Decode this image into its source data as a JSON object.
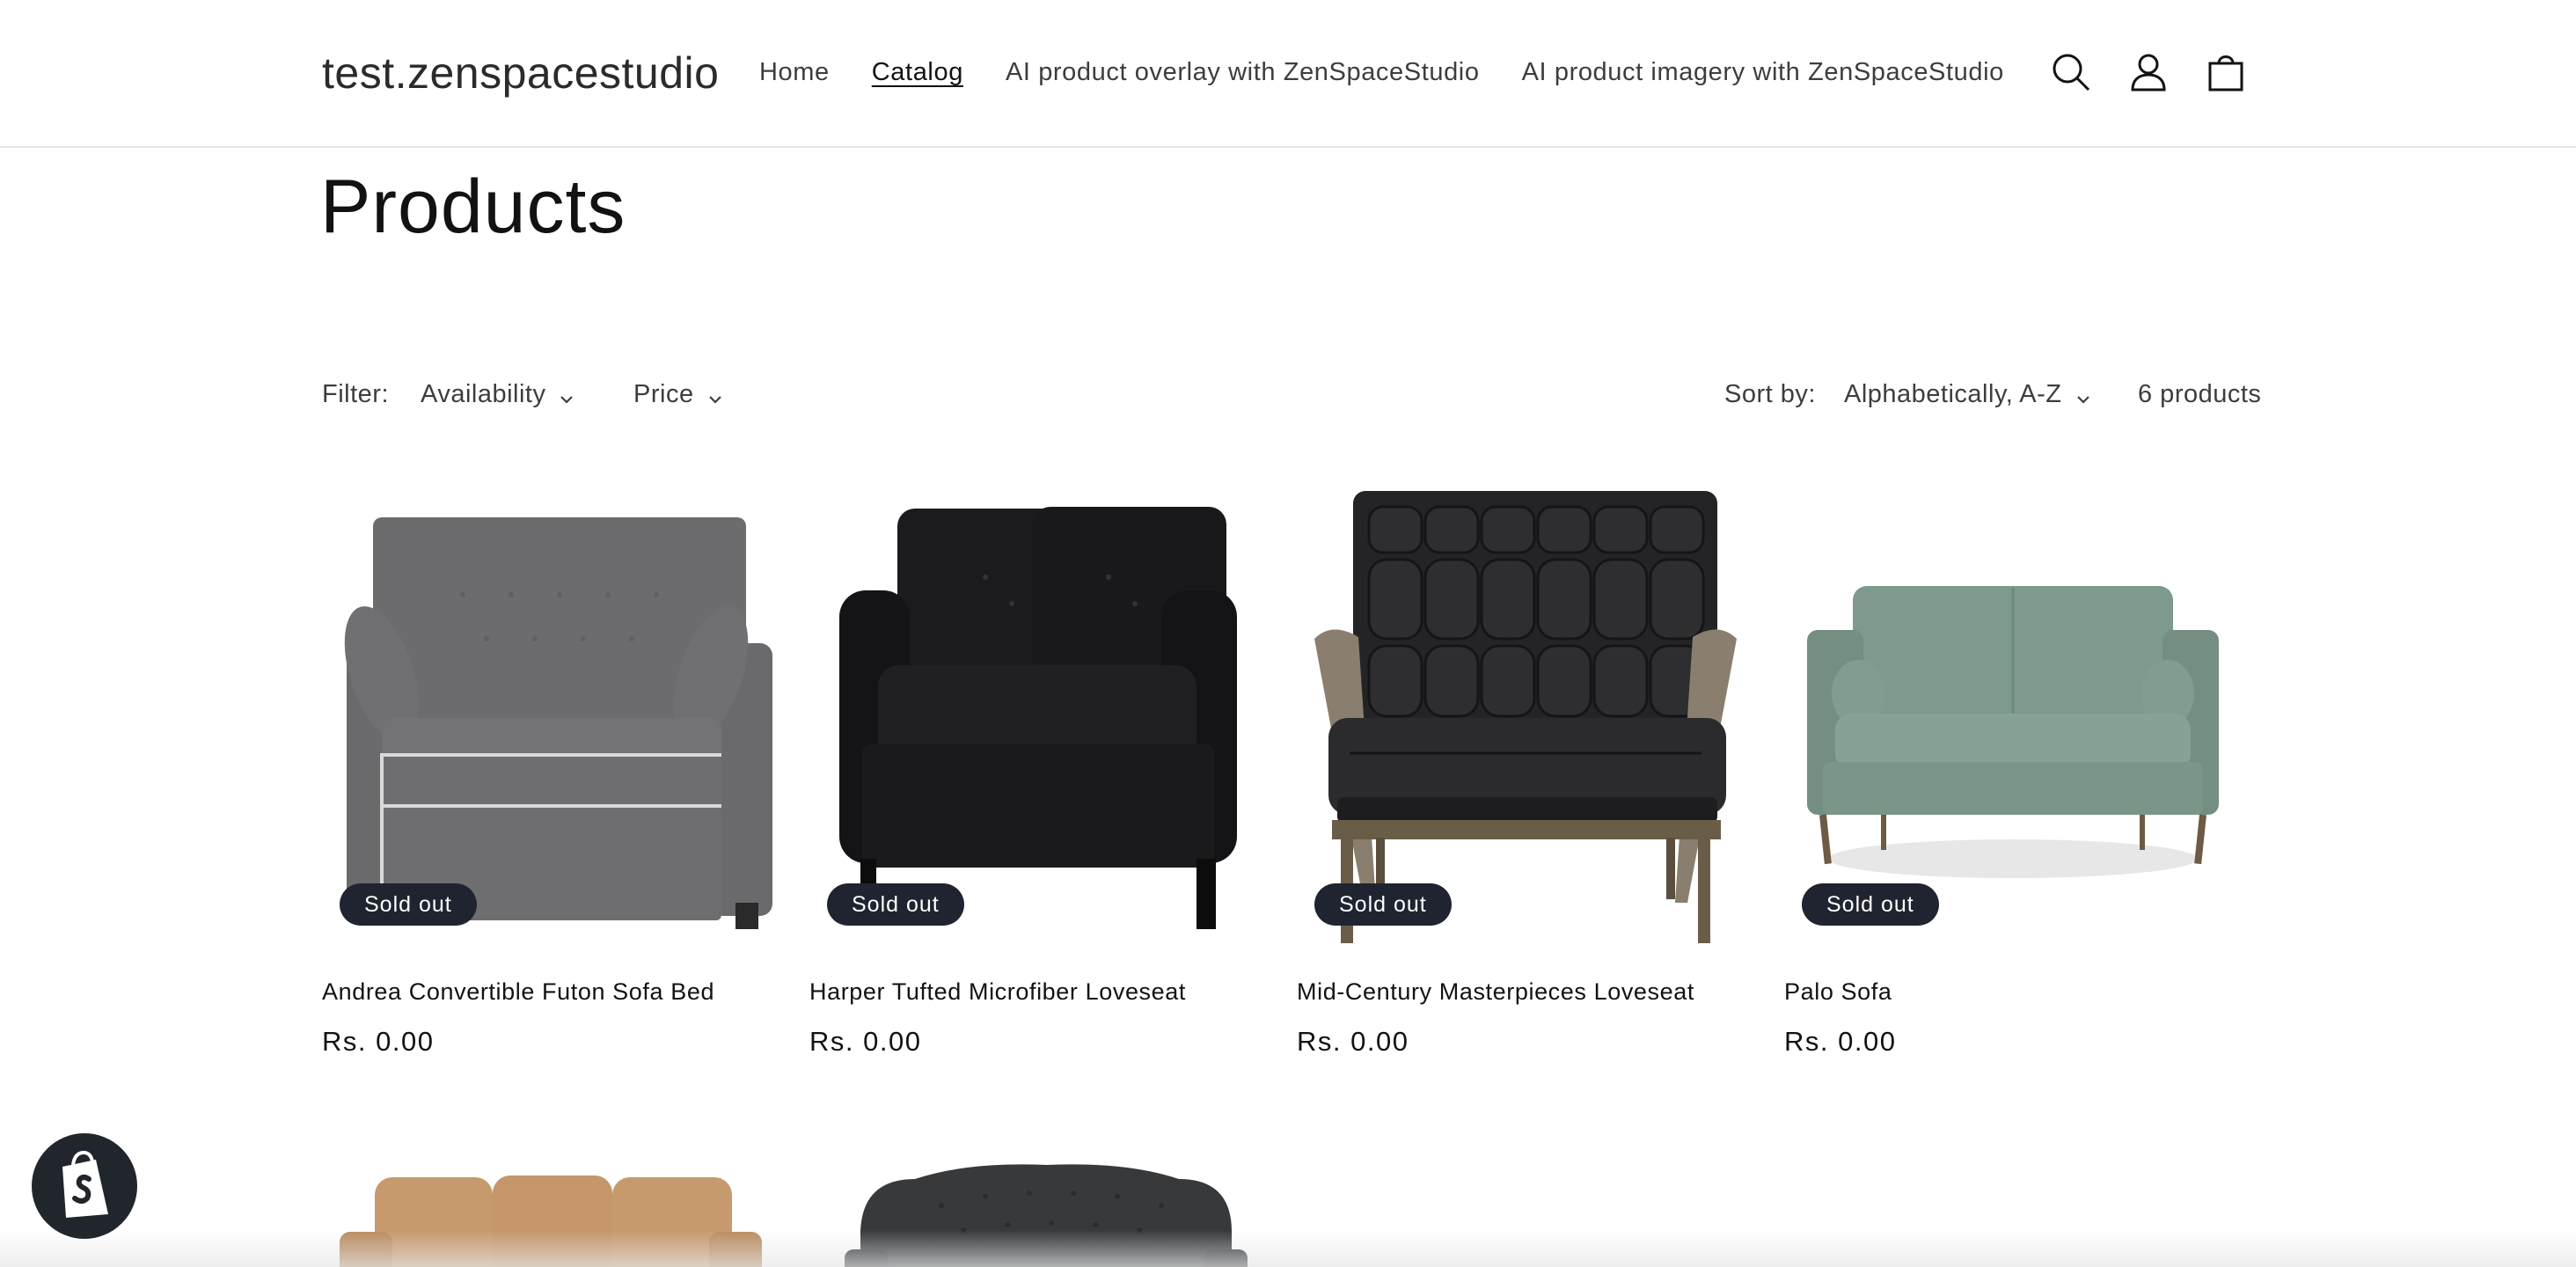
{
  "header": {
    "logo": "test.zenspacestudio",
    "nav": [
      {
        "label": "Home"
      },
      {
        "label": "Catalog",
        "active": true
      },
      {
        "label": "AI product overlay with ZenSpaceStudio"
      },
      {
        "label": "AI product imagery with ZenSpaceStudio"
      }
    ],
    "icons": [
      "search-icon",
      "account-icon",
      "cart-icon"
    ]
  },
  "page": {
    "title": "Products"
  },
  "filters": {
    "label": "Filter:",
    "availability": "Availability",
    "price": "Price",
    "sort_label": "Sort by:",
    "sort_value": "Alphabetically, A-Z",
    "count": "6 products"
  },
  "products": [
    {
      "title": "Andrea Convertible Futon Sofa Bed",
      "price": "Rs. 0.00",
      "badge": "Sold out"
    },
    {
      "title": "Harper Tufted Microfiber Loveseat",
      "price": "Rs. 0.00",
      "badge": "Sold out"
    },
    {
      "title": "Mid-Century Masterpieces Loveseat",
      "price": "Rs. 0.00",
      "badge": "Sold out"
    },
    {
      "title": "Palo Sofa",
      "price": "Rs. 0.00",
      "badge": "Sold out"
    }
  ],
  "colors": {
    "badge_bg": "#1f2430",
    "text": "#121212",
    "sage": "#7d9a8c"
  }
}
